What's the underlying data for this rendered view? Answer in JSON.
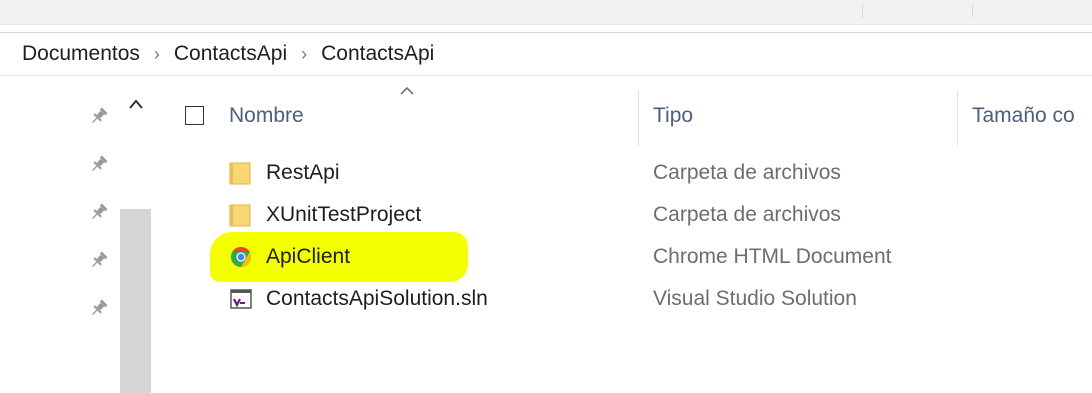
{
  "breadcrumb": {
    "items": [
      "Documentos",
      "ContactsApi",
      "ContactsApi"
    ],
    "separator": "›"
  },
  "columns": {
    "name": "Nombre",
    "type": "Tipo",
    "size": "Tamaño co"
  },
  "files": [
    {
      "name": "RestApi",
      "type": "Carpeta de archivos",
      "icon": "folder-icon"
    },
    {
      "name": "XUnitTestProject",
      "type": "Carpeta de archivos",
      "icon": "folder-icon"
    },
    {
      "name": "ApiClient",
      "type": "Chrome HTML Document",
      "icon": "chrome-icon",
      "highlighted": true
    },
    {
      "name": "ContactsApiSolution.sln",
      "type": "Visual Studio Solution",
      "icon": "visual-studio-solution-icon"
    }
  ],
  "colors": {
    "highlight": "#f4ff00",
    "header_text": "#4c607a",
    "type_text": "#6d6d6d",
    "folder": "#f7d774"
  }
}
